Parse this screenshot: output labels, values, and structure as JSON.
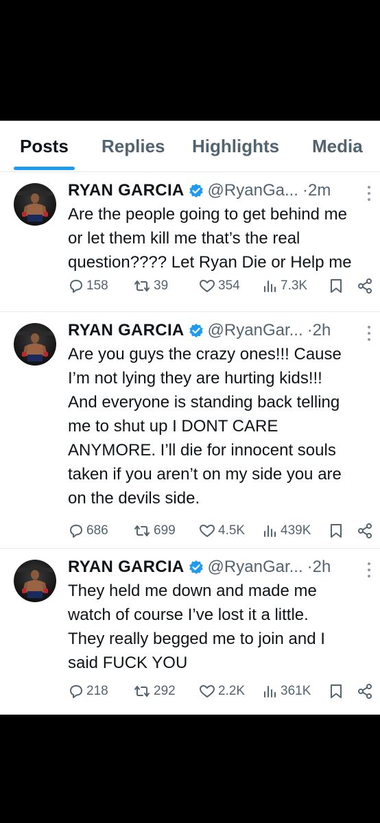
{
  "tabs": [
    {
      "label": "Posts",
      "active": true
    },
    {
      "label": "Replies",
      "active": false
    },
    {
      "label": "Highlights",
      "active": false
    },
    {
      "label": "Media",
      "active": false
    }
  ],
  "accent_color": "#1d9bf0",
  "tweets": [
    {
      "name": "RYAN GARCIA",
      "handle": "@RyanGa...",
      "time": "2m",
      "text": "Are the people going to get behind me\nor let them kill me that’s the real\nquestion???? Let Ryan Die or Help me",
      "replies": "158",
      "reposts": "39",
      "likes": "354",
      "views": "7.3K"
    },
    {
      "name": "RYAN GARCIA",
      "handle": "@RyanGar...",
      "time": "2h",
      "text": "Are you guys the crazy ones!!!  Cause\nI’m not lying they are hurting kids!!!\nAnd everyone is standing back telling\nme to shut up I DONT CARE\nANYMORE. I’ll die for innocent souls\ntaken if you aren’t on my side you are\non the devils side.",
      "replies": "686",
      "reposts": "699",
      "likes": "4.5K",
      "views": "439K"
    },
    {
      "name": "RYAN GARCIA",
      "handle": "@RyanGar...",
      "time": "2h",
      "text": "They held me down and made me\nwatch of course I’ve lost it a little.\nThey really begged me to join and I\nsaid FUCK YOU",
      "replies": "218",
      "reposts": "292",
      "likes": "2.2K",
      "views": "361K"
    }
  ]
}
